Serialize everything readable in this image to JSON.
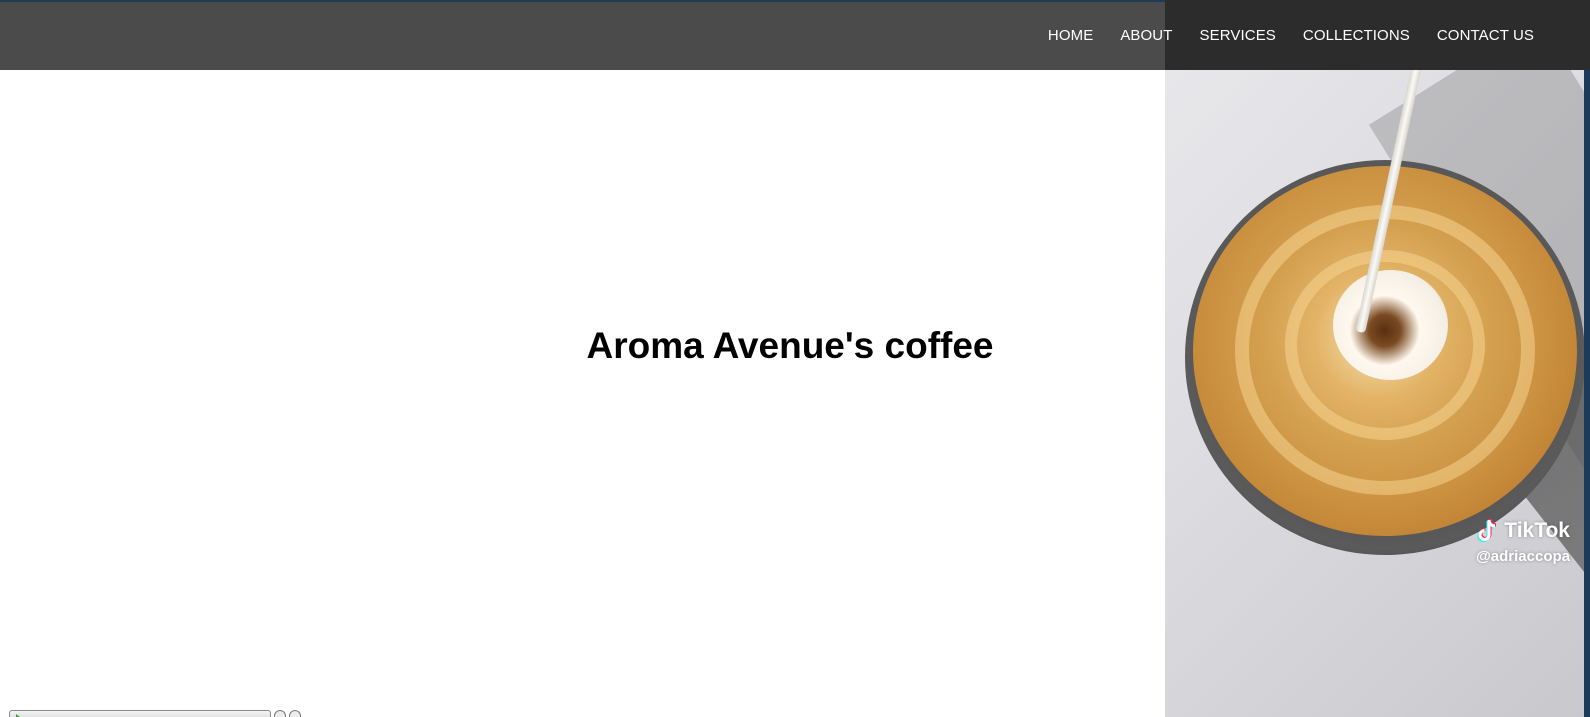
{
  "nav": {
    "items": [
      {
        "label": "HOME"
      },
      {
        "label": "ABOUT"
      },
      {
        "label": "SERVICES"
      },
      {
        "label": "COLLECTIONS"
      },
      {
        "label": "CONTACT US"
      }
    ]
  },
  "hero": {
    "title": "Aroma Avenue's coffee"
  },
  "media": {
    "watermark_brand": "TikTok",
    "watermark_handle": "@adriaccopa",
    "icon": "tiktok-logo-icon"
  },
  "colors": {
    "navbar": "#4b4b4b",
    "navbar_dark": "#2c2c2c",
    "nav_text": "#ffffff",
    "title": "#000000"
  },
  "player_bar": {
    "icons": [
      "play-icon",
      "help-icon",
      "close-icon"
    ]
  }
}
